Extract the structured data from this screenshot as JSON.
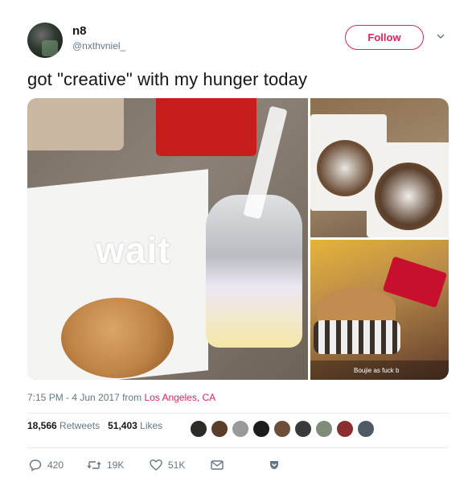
{
  "author": {
    "display_name": "n8",
    "handle": "@nxthvniel_"
  },
  "follow_label": "Follow",
  "tweet_text": "got \"creative\" with my hunger today",
  "media": {
    "overlay_text": "wait",
    "caption_tag": "Boujie as fuck b"
  },
  "meta": {
    "time": "7:15 PM - 4 Jun 2017",
    "from_label": "from",
    "location": "Los Angeles, CA"
  },
  "stats": {
    "retweets_count": "18,566",
    "retweets_label": "Retweets",
    "likes_count": "51,403",
    "likes_label": "Likes"
  },
  "actions": {
    "replies": "420",
    "retweets": "19K",
    "likes": "51K"
  },
  "colors": {
    "accent": "#e0245e",
    "muted": "#657786",
    "text": "#14171a"
  },
  "icons": [
    "chevron-down-icon",
    "reply-icon",
    "retweet-icon",
    "heart-icon",
    "message-icon",
    "bookmark-icon"
  ]
}
